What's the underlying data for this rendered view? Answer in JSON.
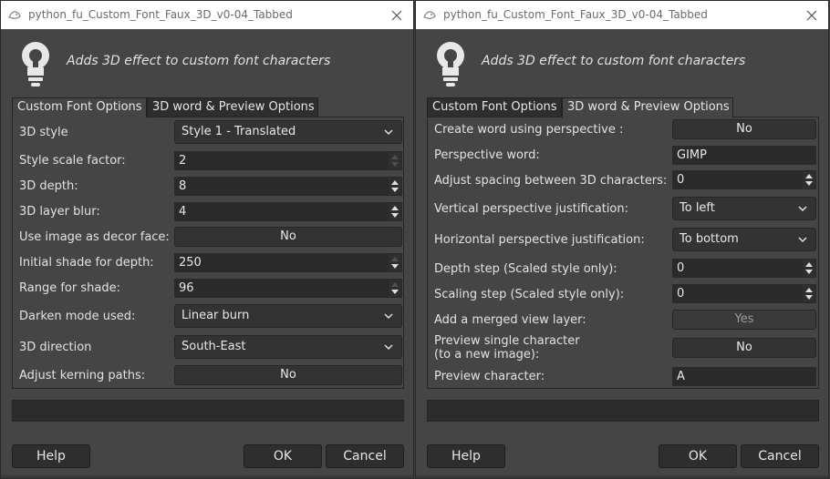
{
  "windows": [
    {
      "title": "python_fu_Custom_Font_Faux_3D_v0-04_Tabbed",
      "description": "Adds 3D effect to custom font characters",
      "tabs": [
        "Custom Font Options",
        "3D word & Preview Options"
      ],
      "active_tab": 0,
      "fields": [
        {
          "label": "3D style",
          "type": "combo",
          "value": "Style 1 - Translated"
        },
        {
          "label": "Style scale factor:",
          "type": "spin",
          "value": "2"
        },
        {
          "label": "3D depth:",
          "type": "spin",
          "value": "8"
        },
        {
          "label": "3D layer blur:",
          "type": "spin",
          "value": "4"
        },
        {
          "label": "Use image as decor face:",
          "type": "toggle",
          "value": "No"
        },
        {
          "label": "Initial shade for depth:",
          "type": "spin",
          "value": "250"
        },
        {
          "label": "Range for shade:",
          "type": "spin",
          "value": "96"
        },
        {
          "label": "Darken mode used:",
          "type": "combo",
          "value": "Linear burn"
        },
        {
          "label": "3D direction",
          "type": "combo",
          "value": "South-East"
        },
        {
          "label": "Adjust kerning paths:",
          "type": "toggle",
          "value": "No"
        }
      ],
      "buttons": {
        "help": "Help",
        "ok": "OK",
        "cancel": "Cancel"
      }
    },
    {
      "title": "python_fu_Custom_Font_Faux_3D_v0-04_Tabbed",
      "description": "Adds 3D effect to custom font characters",
      "tabs": [
        "Custom Font Options",
        "3D word & Preview Options"
      ],
      "active_tab": 1,
      "fields": [
        {
          "label": "Create word using perspective :",
          "type": "toggle",
          "value": "No"
        },
        {
          "label": "Perspective word:",
          "type": "entry",
          "value": "GIMP"
        },
        {
          "label": "Adjust spacing between 3D characters:",
          "type": "spin",
          "value": "0"
        },
        {
          "label": "Vertical perspective justification:",
          "type": "combo",
          "value": "To left"
        },
        {
          "label": "Horizontal perspective justification:",
          "type": "combo",
          "value": "To bottom"
        },
        {
          "label": "Depth step (Scaled style only):",
          "type": "spin",
          "value": "0"
        },
        {
          "label": "Scaling step (Scaled style only):",
          "type": "spin",
          "value": "0"
        },
        {
          "label": "Add a merged view layer:",
          "type": "toggle",
          "value": "Yes",
          "disabled": true
        },
        {
          "label_line1": "Preview single character",
          "label_line2": "(to a new image):",
          "type": "toggle",
          "value": "No"
        },
        {
          "label": "Preview character:",
          "type": "entry",
          "value": "A"
        }
      ],
      "buttons": {
        "help": "Help",
        "ok": "OK",
        "cancel": "Cancel"
      }
    }
  ],
  "colors": {
    "dialog_bg": "#454545",
    "widget_bg": "#333333",
    "entry_bg": "#2a2a2a",
    "text": "#e2e2e2",
    "titlebar_bg": "#ffffff"
  },
  "icons": [
    "gimp-logo-icon",
    "close-icon",
    "lightbulb-icon",
    "chevron-down-icon",
    "spin-up-icon",
    "spin-down-icon"
  ]
}
